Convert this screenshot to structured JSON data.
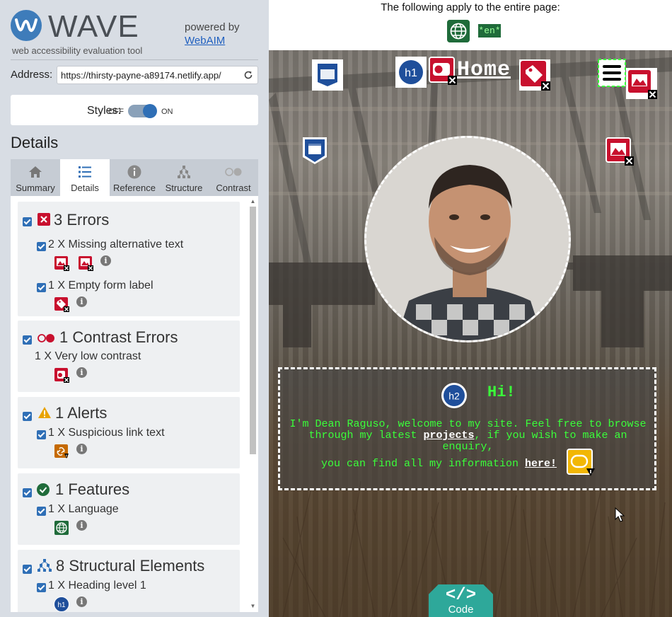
{
  "wave": {
    "logo_text": "WAVE",
    "tagline": "web accessibility evaluation tool",
    "powered_by": "powered by",
    "powered_link": "WebAIM",
    "address_label": "Address:",
    "address_value": "https://thirsty-payne-a89174.netlify.app/",
    "styles_label": "Styles:",
    "styles_off": "OFF",
    "styles_on": "ON",
    "details_heading": "Details",
    "tabs": [
      {
        "label": "Summary",
        "icon": "home-icon"
      },
      {
        "label": "Details",
        "icon": "list-icon",
        "active": true
      },
      {
        "label": "Reference",
        "icon": "info-icon"
      },
      {
        "label": "Structure",
        "icon": "hierarchy-icon"
      },
      {
        "label": "Contrast",
        "icon": "contrast-icon"
      }
    ],
    "groups": {
      "errors": {
        "title": "3 Errors",
        "items": [
          "2 X Missing alternative text",
          "1 X Empty form label"
        ]
      },
      "contrast": {
        "title": "1 Contrast Errors",
        "items": [
          "1 X Very low contrast"
        ]
      },
      "alerts": {
        "title": "1 Alerts",
        "items": [
          "1 X Suspicious link text"
        ]
      },
      "features": {
        "title": "1 Features",
        "items": [
          "1 X Language"
        ]
      },
      "structure": {
        "title": "8 Structural Elements",
        "items": [
          "1 X Heading level 1"
        ]
      }
    },
    "colors": {
      "accent": "#2f6fb6",
      "error": "#c8102e",
      "alert": "#e8a300",
      "feature": "#1f6b3a"
    }
  },
  "page": {
    "banner_text": "The following apply to the entire page:",
    "lang_badge": "*en*",
    "h1_text": "Home",
    "h2_text": "Hi!",
    "intro_text_1": "I'm Dean Raguso, welcome to my site. Feel free to browse through my latest ",
    "projects_link": "projects",
    "intro_text_2": ", if you wish to make an enquiry,",
    "intro_text_3": "you can find all my information ",
    "here_link": "here!",
    "code_glyph": "</>",
    "code_label": "Code",
    "icon_labels": {
      "h1": "h1",
      "h2": "h2"
    }
  }
}
